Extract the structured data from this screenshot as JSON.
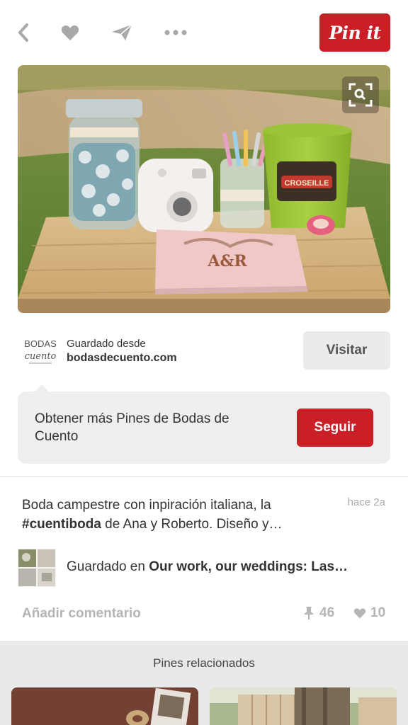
{
  "toolbar": {
    "pin_it_label": "Pin it",
    "back_icon": "chevron-left-icon",
    "like_icon": "heart-icon",
    "send_icon": "paper-plane-icon",
    "more_icon": "more-dots-icon"
  },
  "pin": {
    "image_alt": "Mesa rústica de madera con tarro de chapas, cámara instantánea, lápices, libro de firmas A&R y maceta verde",
    "zoom_icon": "visual-search-icon",
    "book_monogram": "A&R",
    "pot_label": "CROSEILLE"
  },
  "source": {
    "logo_line1": "BODAS",
    "logo_line2": "cuento",
    "saved_from_label": "Guardado desde",
    "domain": "bodasdecuento.com",
    "visit_label": "Visitar"
  },
  "follow": {
    "text": "Obtener más Pines de Bodas de Cuento",
    "button_label": "Seguir"
  },
  "description": {
    "text_before": "Boda campestre con inpiración italiana, la",
    "hashtag": "#cuentiboda",
    "text_after": " de Ana y Roberto. Diseño y…",
    "time": "hace 2a"
  },
  "board": {
    "saved_in_label": "Guardado en ",
    "board_name": "Our work, our weddings: Las…"
  },
  "actions": {
    "add_comment_label": "Añadir comentario",
    "repins": "46",
    "likes": "10"
  },
  "related": {
    "title": "Pines relacionados"
  },
  "colors": {
    "brand_red": "#cb1f27",
    "button_gray": "#ebebeb",
    "muted_text": "#b5b5b5"
  }
}
